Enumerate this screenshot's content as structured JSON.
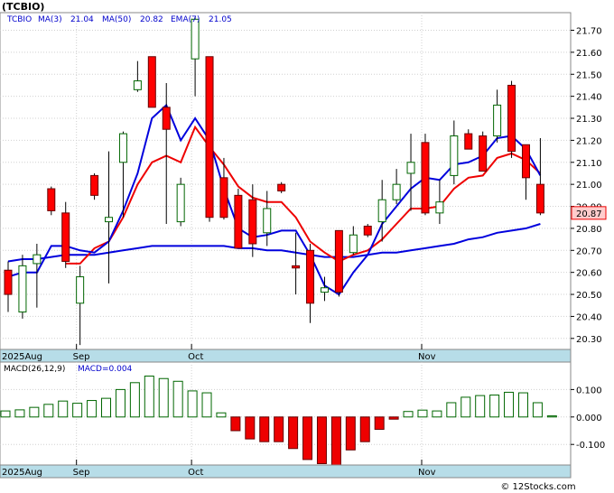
{
  "title": "(TCBIO)",
  "symbol": "TCBIO",
  "legend_price": [
    {
      "label": "MA(3)",
      "value": "21.04"
    },
    {
      "label": "MA(50)",
      "value": "20.82"
    },
    {
      "label": "EMA(7)",
      "value": "21.05"
    }
  ],
  "legend_macd": {
    "label": "MACD(26,12,9)",
    "value_label": "MACD=0.004"
  },
  "last_price_label": "20.87",
  "watermark": "© 12Stocks.com",
  "colors": {
    "up_candle": "#ffffff",
    "down_candle": "#ff0000",
    "ma3": "#0000dd",
    "ma50": "#0000dd",
    "ema7": "#ee0000",
    "macd_up": "#ffffff",
    "macd_down": "#ee0000",
    "axis_band": "#b7dde8"
  },
  "chart_data": [
    {
      "type": "candlestick",
      "title": "(TCBIO)",
      "ylim": [
        20.25,
        21.78
      ],
      "y_ticks": [
        "20.30",
        "20.40",
        "20.50",
        "20.60",
        "20.70",
        "20.80",
        "20.90",
        "21.00",
        "21.10",
        "21.20",
        "21.30",
        "21.40",
        "21.50",
        "21.60",
        "21.70"
      ],
      "x_tick_labels": [
        {
          "label": "2025Aug",
          "bar": 0
        },
        {
          "label": "Sep",
          "bar": 5
        },
        {
          "label": "Oct",
          "bar": 13
        },
        {
          "label": "Nov",
          "bar": 29
        }
      ],
      "candles": [
        {
          "o": 20.61,
          "h": 20.65,
          "l": 20.42,
          "c": 20.5
        },
        {
          "o": 20.42,
          "h": 20.68,
          "l": 20.39,
          "c": 20.63
        },
        {
          "o": 20.64,
          "h": 20.73,
          "l": 20.44,
          "c": 20.68
        },
        {
          "o": 20.98,
          "h": 20.99,
          "l": 20.86,
          "c": 20.88
        },
        {
          "o": 20.87,
          "h": 20.92,
          "l": 20.62,
          "c": 20.65
        },
        {
          "o": 20.46,
          "h": 20.63,
          "l": 20.27,
          "c": 20.58
        },
        {
          "o": 21.04,
          "h": 21.05,
          "l": 20.93,
          "c": 20.95
        },
        {
          "o": 20.83,
          "h": 21.15,
          "l": 20.55,
          "c": 20.85
        },
        {
          "o": 21.1,
          "h": 21.24,
          "l": 20.85,
          "c": 21.23
        },
        {
          "o": 21.43,
          "h": 21.56,
          "l": 21.42,
          "c": 21.47
        },
        {
          "o": 21.58,
          "h": 21.58,
          "l": 21.35,
          "c": 21.35
        },
        {
          "o": 21.35,
          "h": 21.46,
          "l": 20.82,
          "c": 21.25
        },
        {
          "o": 20.83,
          "h": 21.03,
          "l": 20.81,
          "c": 21.0
        },
        {
          "o": 21.57,
          "h": 21.76,
          "l": 21.4,
          "c": 21.75
        },
        {
          "o": 21.58,
          "h": 21.58,
          "l": 20.83,
          "c": 20.85
        },
        {
          "o": 21.03,
          "h": 21.12,
          "l": 20.84,
          "c": 20.85
        },
        {
          "o": 20.95,
          "h": 20.98,
          "l": 20.71,
          "c": 20.71
        },
        {
          "o": 20.93,
          "h": 21.0,
          "l": 20.67,
          "c": 20.73
        },
        {
          "o": 20.78,
          "h": 20.97,
          "l": 20.72,
          "c": 20.89
        },
        {
          "o": 21.0,
          "h": 21.01,
          "l": 20.96,
          "c": 20.97
        },
        {
          "o": 20.63,
          "h": 20.78,
          "l": 20.5,
          "c": 20.62
        },
        {
          "o": 20.7,
          "h": 20.73,
          "l": 20.37,
          "c": 20.46
        },
        {
          "o": 20.51,
          "h": 20.58,
          "l": 20.47,
          "c": 20.53
        },
        {
          "o": 20.79,
          "h": 20.79,
          "l": 20.49,
          "c": 20.51
        },
        {
          "o": 20.69,
          "h": 20.81,
          "l": 20.68,
          "c": 20.77
        },
        {
          "o": 20.81,
          "h": 20.82,
          "l": 20.76,
          "c": 20.77
        },
        {
          "o": 20.83,
          "h": 21.02,
          "l": 20.74,
          "c": 20.93
        },
        {
          "o": 20.93,
          "h": 21.07,
          "l": 20.91,
          "c": 21.0
        },
        {
          "o": 21.05,
          "h": 21.23,
          "l": 20.88,
          "c": 21.1
        },
        {
          "o": 21.19,
          "h": 21.23,
          "l": 20.86,
          "c": 20.87
        },
        {
          "o": 20.87,
          "h": 21.02,
          "l": 20.82,
          "c": 20.92
        },
        {
          "o": 21.04,
          "h": 21.29,
          "l": 21.0,
          "c": 21.22
        },
        {
          "o": 21.23,
          "h": 21.25,
          "l": 21.16,
          "c": 21.16
        },
        {
          "o": 21.22,
          "h": 21.24,
          "l": 21.07,
          "c": 21.06
        },
        {
          "o": 21.22,
          "h": 21.43,
          "l": 21.19,
          "c": 21.36
        },
        {
          "o": 21.45,
          "h": 21.47,
          "l": 21.12,
          "c": 21.15
        },
        {
          "o": 21.18,
          "h": 21.18,
          "l": 20.93,
          "c": 21.03
        },
        {
          "o": 21.0,
          "h": 21.21,
          "l": 20.86,
          "c": 20.87
        }
      ],
      "series": [
        {
          "name": "MA(3)",
          "values": [
            20.58,
            20.6,
            20.6,
            20.72,
            20.72,
            20.7,
            20.69,
            20.74,
            20.88,
            21.05,
            21.3,
            21.36,
            21.2,
            21.3,
            21.2,
            20.98,
            20.8,
            20.76,
            20.77,
            20.79,
            20.79,
            20.68,
            20.54,
            20.5,
            20.6,
            20.68,
            20.82,
            20.9,
            20.98,
            21.03,
            21.02,
            21.09,
            21.1,
            21.13,
            21.21,
            21.22,
            21.16,
            21.04
          ]
        },
        {
          "name": "EMA(7)",
          "values": [
            null,
            null,
            null,
            null,
            20.64,
            20.64,
            20.71,
            20.74,
            20.85,
            21.0,
            21.1,
            21.13,
            21.1,
            21.26,
            21.17,
            21.09,
            20.99,
            20.94,
            20.92,
            20.92,
            20.85,
            20.74,
            20.69,
            20.65,
            20.68,
            20.7,
            20.75,
            20.82,
            20.89,
            20.89,
            20.9,
            20.98,
            21.03,
            21.04,
            21.12,
            21.14,
            21.11,
            21.05
          ]
        },
        {
          "name": "MA(50)",
          "values": [
            20.65,
            20.66,
            20.66,
            20.67,
            20.68,
            20.68,
            20.68,
            20.69,
            20.7,
            20.71,
            20.72,
            20.72,
            20.72,
            20.72,
            20.72,
            20.72,
            20.71,
            20.71,
            20.7,
            20.7,
            20.69,
            20.68,
            20.67,
            20.67,
            20.67,
            20.68,
            20.69,
            20.69,
            20.7,
            20.71,
            20.72,
            20.73,
            20.75,
            20.76,
            20.78,
            20.79,
            20.8,
            20.82
          ]
        }
      ]
    },
    {
      "type": "bar",
      "title": "MACD(26,12,9)",
      "ylim": [
        -0.175,
        0.2
      ],
      "y_ticks": [
        "0.100",
        "0.000",
        "-0.100"
      ],
      "x_tick_labels": [
        {
          "label": "2025Aug",
          "bar": 0
        },
        {
          "label": "Sep",
          "bar": 5
        },
        {
          "label": "Oct",
          "bar": 13
        },
        {
          "label": "Nov",
          "bar": 29
        }
      ],
      "values": [
        0.022,
        0.026,
        0.035,
        0.046,
        0.058,
        0.05,
        0.06,
        0.068,
        0.1,
        0.125,
        0.149,
        0.14,
        0.13,
        0.095,
        0.088,
        0.015,
        -0.05,
        -0.08,
        -0.09,
        -0.09,
        -0.115,
        -0.155,
        -0.17,
        -0.18,
        -0.12,
        -0.09,
        -0.045,
        -0.008,
        0.02,
        0.025,
        0.022,
        0.052,
        0.072,
        0.078,
        0.08,
        0.09,
        0.088,
        0.052,
        0.004
      ]
    }
  ]
}
